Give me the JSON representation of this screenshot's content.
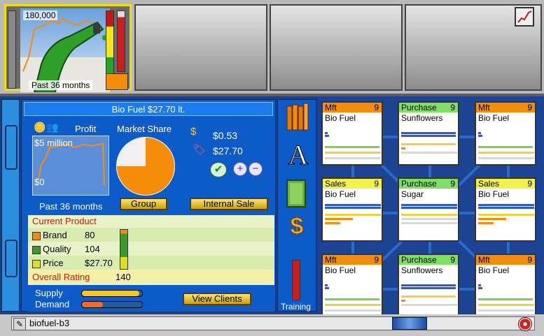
{
  "top": {
    "thumbnail": {
      "value": "180,000",
      "caption": "Past 36 months",
      "icon": "fuel-nozzle-image",
      "bar_fill": 0.75
    },
    "chart_button_icon": "line-chart-icon"
  },
  "product": {
    "title": "Bio Fuel  $27.70 lt.",
    "profit_label": "Profit",
    "market_share_label": "Market Share",
    "profit_high": "$5 million",
    "profit_low": "$0",
    "period": "Past 36 months",
    "cost_value": "$0.53",
    "price_value": "$27.70",
    "group_button": "Group",
    "internal_sale_button": "Internal Sale",
    "market_share_fraction": 0.75
  },
  "current_product": {
    "heading": "Current Product",
    "rows": [
      {
        "label": "Brand",
        "value": "80",
        "color": "#f58c0a"
      },
      {
        "label": "Quality",
        "value": "104",
        "color": "#3a9a2a"
      },
      {
        "label": "Price",
        "value": "$27.70",
        "color": "#e0e020"
      }
    ],
    "overall_label": "Overall Rating",
    "overall_value": "140"
  },
  "supply_demand": {
    "supply_label": "Supply",
    "demand_label": "Demand",
    "view_clients_button": "View Clients",
    "supply_level": 0.95,
    "demand_level": 0.35
  },
  "icon_column": {
    "training_label": "Training",
    "icons": [
      "bookshelf-icon",
      "letter-a-icon",
      "book-icon",
      "dollar-icon"
    ]
  },
  "units": [
    {
      "type": "Mft",
      "num": "9",
      "name": "Bio Fuel",
      "hdr": "#f58c0a"
    },
    {
      "type": "Purchase",
      "num": "9",
      "name": "Sunflowers",
      "hdr": "#7ee060"
    },
    {
      "type": "Mft",
      "num": "9",
      "name": "Bio Fuel",
      "hdr": "#f58c0a"
    },
    {
      "type": "Sales",
      "num": "9",
      "name": "Bio Fuel",
      "hdr": "#f4f24a"
    },
    {
      "type": "Purchase",
      "num": "9",
      "name": "Sugar",
      "hdr": "#7ee060"
    },
    {
      "type": "Sales",
      "num": "9",
      "name": "Bio Fuel",
      "hdr": "#f4f24a"
    },
    {
      "type": "Mft",
      "num": "9",
      "name": "Bio Fuel",
      "hdr": "#f58c0a"
    },
    {
      "type": "Purchase",
      "num": "9",
      "name": "Sunflowers",
      "hdr": "#7ee060"
    },
    {
      "type": "Mft",
      "num": "9",
      "name": "Bio Fuel",
      "hdr": "#f58c0a"
    }
  ],
  "status": {
    "firm_name": "biofuel-b3"
  }
}
